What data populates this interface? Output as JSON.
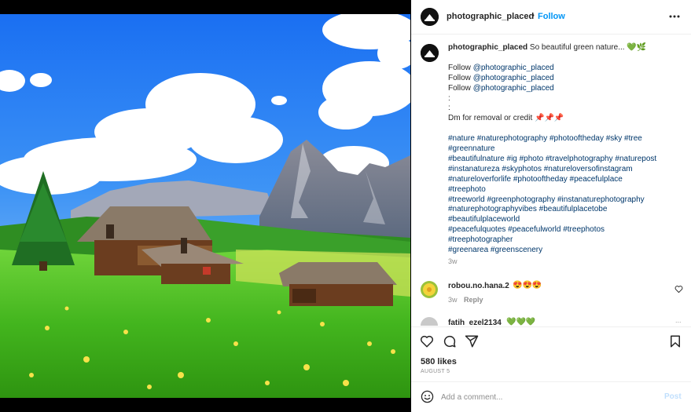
{
  "post": {
    "username": "photographic_placed",
    "dot": "•",
    "follow_label": "Follow",
    "more_icon": "more-horizontal-icon"
  },
  "caption": {
    "username": "photographic_placed",
    "text": "So beautiful green nature... 💚🌿",
    "follow_prefix": "Follow ",
    "mentions": [
      "@photographic_placed",
      "@photographic_placed",
      "@photographic_placed"
    ],
    "colons": [
      ":",
      ":"
    ],
    "dm_text": "Dm for removal or credit 📌📌📌",
    "hashtag_lines": [
      "#nature #naturephotography #photooftheday #sky #tree",
      "#greennature",
      "#beautifulnature #ig #photo #travelphotography #naturepost",
      "#instanatureza #skyphotos #natureloversofinstagram",
      "#natureloverforlife #photooftheday #peacefulplace",
      "#treephoto",
      "#treeworld #greenphotography #instanaturephotography",
      "#naturephotographyvibes #beautifulplacetobe",
      "#beautifulplaceworld",
      "#peacefulquotes #peacefulworld #treephotos",
      "#treephotographer",
      "#greenarea #greenscenery"
    ],
    "time": "3w"
  },
  "comments": [
    {
      "username": "robou.no.hana.2",
      "text": "😍😍😍",
      "time": "3w",
      "reply_label": "Reply"
    },
    {
      "username": "fatih_ezel2134",
      "text": "💚💚💚",
      "dots": "..."
    }
  ],
  "actions": {
    "likes": "580 likes",
    "date": "AUGUST 5"
  },
  "add_comment": {
    "placeholder": "Add a comment...",
    "post_label": "Post"
  },
  "colors": {
    "accent": "#0095f6",
    "link": "#00376b",
    "muted": "#8e8e8e"
  }
}
